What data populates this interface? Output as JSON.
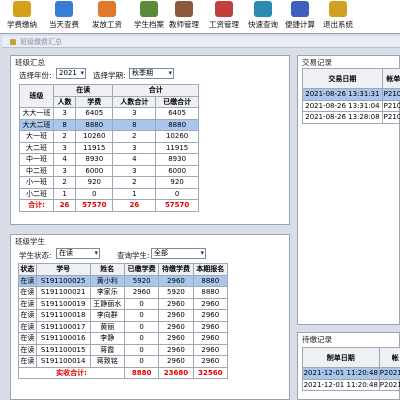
{
  "toolbar": {
    "items": [
      {
        "label": "学费缴纳",
        "icon": "coins-icon",
        "color": "#d4a017"
      },
      {
        "label": "当天查费",
        "icon": "calendar-search-icon",
        "color": "#3a7bd5"
      },
      {
        "label": "发放工资",
        "icon": "money-bag-icon",
        "color": "#e07a2a"
      },
      {
        "label": "学生档案",
        "icon": "student-folder-icon",
        "color": "#5a8a3a"
      },
      {
        "label": "教师管理",
        "icon": "teacher-icon",
        "color": "#8a5a3a"
      },
      {
        "label": "工资管理",
        "icon": "wallet-icon",
        "color": "#c04040"
      },
      {
        "label": "快速查询",
        "icon": "magnifier-icon",
        "color": "#2a8ab0"
      },
      {
        "label": "便捷计算",
        "icon": "calculator-icon",
        "color": "#4060c0"
      },
      {
        "label": "退出系统",
        "icon": "exit-icon",
        "color": "#d0a020"
      }
    ]
  },
  "window_title": "班级缴费汇总",
  "summary": {
    "title": "班级汇总",
    "year_label": "选择年份:",
    "year_value": "2021",
    "term_label": "选择学期:",
    "term_value": "秋季期",
    "head_class": "班级",
    "head_enrolled": "在读",
    "head_total": "合计",
    "sub": [
      "人数",
      "学费",
      "人数合计",
      "已缴合计"
    ],
    "rows": [
      [
        "大大一班",
        "3",
        "6405",
        "3",
        "6405"
      ],
      [
        "大大二班",
        "8",
        "8880",
        "8",
        "8880"
      ],
      [
        "大一班",
        "2",
        "10260",
        "2",
        "10260"
      ],
      [
        "大二班",
        "3",
        "11915",
        "3",
        "11915"
      ],
      [
        "中一班",
        "4",
        "8930",
        "4",
        "8930"
      ],
      [
        "中二班",
        "3",
        "6000",
        "3",
        "6000"
      ],
      [
        "小一班",
        "2",
        "920",
        "2",
        "920"
      ],
      [
        "小二班",
        "1",
        "0",
        "1",
        "0"
      ]
    ],
    "total": [
      "合计:",
      "26",
      "57570",
      "26",
      "57570"
    ]
  },
  "students": {
    "title": "班级学生",
    "status_label": "学生状态:",
    "status_value": "在读",
    "query_label": "查询学生:",
    "query_value": "全部",
    "headers": [
      "状态",
      "学号",
      "姓名",
      "已缴学费",
      "待缴学费",
      "本期报名"
    ],
    "rows": [
      [
        "在读",
        "S191100025",
        "黄小利",
        "5920",
        "2960",
        "8880"
      ],
      [
        "在读",
        "S191100021",
        "李家乐",
        "2960",
        "5920",
        "8880"
      ],
      [
        "在读",
        "S191100019",
        "王静丽水",
        "0",
        "2960",
        "2960"
      ],
      [
        "在读",
        "S191100018",
        "李向群",
        "0",
        "2960",
        "2960"
      ],
      [
        "在读",
        "S191100017",
        "黄丽",
        "0",
        "2960",
        "2960"
      ],
      [
        "在读",
        "S191100016",
        "李静",
        "0",
        "2960",
        "2960"
      ],
      [
        "在读",
        "S191100015",
        "蒋霞",
        "0",
        "2960",
        "2960"
      ],
      [
        "在读",
        "S191100014",
        "蒋致铭",
        "0",
        "2960",
        "2960"
      ]
    ],
    "total": [
      "实收合计:",
      "8880",
      "23680",
      "32560"
    ]
  },
  "transactions": {
    "title": "交易记录",
    "headers": [
      "交易日期",
      "帐单编"
    ],
    "rows": [
      [
        "2021-08-26 13:31:31",
        "P21080"
      ],
      [
        "2021-08-26 13:31:04",
        "P21080"
      ],
      [
        "2021-08-26 13:28:08",
        "P21080"
      ]
    ]
  },
  "pending": {
    "title": "待缴记录",
    "headers": [
      "制单日期",
      "帐"
    ],
    "rows": [
      [
        "2021-12-01 11:20:48",
        "P202112"
      ],
      [
        "2021-12-01 11:20:48",
        "P202112"
      ]
    ]
  }
}
